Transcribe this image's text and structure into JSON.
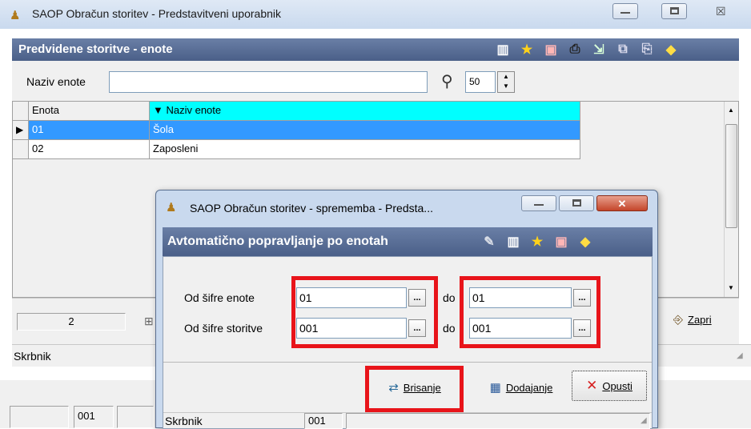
{
  "main_window": {
    "title": "SAOP Obračun storitev - Predstavitveni uporabnik",
    "panel_title": "Predvidene storitve - enote",
    "search_label": "Naziv enote",
    "search_value": "",
    "row_limit": "50",
    "columns": [
      "Enota",
      "▼ Naziv enote"
    ],
    "rows": [
      {
        "code": "01",
        "name": "Šola"
      },
      {
        "code": "02",
        "name": "Zaposleni"
      }
    ],
    "record_count": "2",
    "close_label": "Zapri",
    "status_left": "Skrbnik",
    "bottom_code": "001"
  },
  "dialog": {
    "title": "SAOP Obračun storitev - sprememba - Predsta...",
    "panel_title": "Avtomatično popravljanje po enotah",
    "unit_from_label": "Od šifre enote",
    "unit_from": "01",
    "unit_to_label": "do",
    "unit_to": "01",
    "service_from_label": "Od šifre storitve",
    "service_from": "001",
    "service_to_label": "do",
    "service_to": "001",
    "ellipsis": "...",
    "delete_label": "Brisanje",
    "add_label": "Dodajanje",
    "cancel_label": "Opusti",
    "status_user": "Skrbnik",
    "status_code": "001"
  },
  "colors": {
    "selected_row": "#3399ff",
    "header_highlight": "#00ffff",
    "highlight_box": "#e8141a",
    "panel_bar": "#5a6f96"
  }
}
